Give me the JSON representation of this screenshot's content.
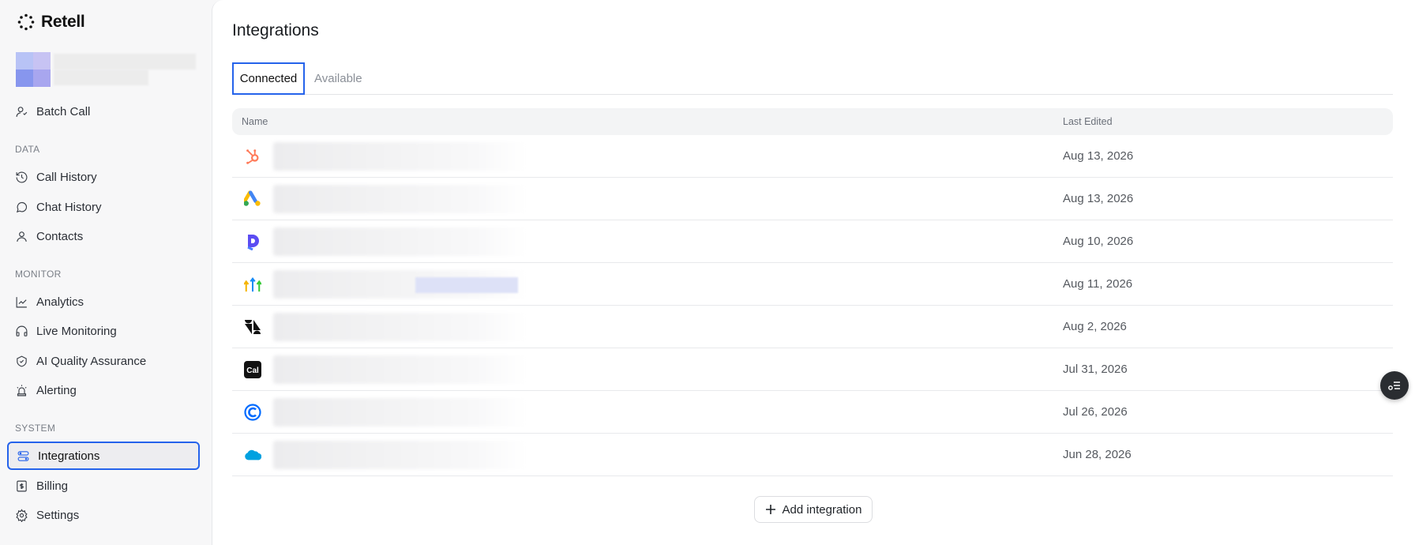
{
  "brand": {
    "name": "Retell"
  },
  "sidebar": {
    "top_items": [
      {
        "label": "Batch Call",
        "icon": "batch-call-icon"
      }
    ],
    "sections": [
      {
        "label": "DATA",
        "items": [
          {
            "label": "Call History",
            "icon": "history-icon"
          },
          {
            "label": "Chat History",
            "icon": "chat-icon"
          },
          {
            "label": "Contacts",
            "icon": "user-icon"
          }
        ]
      },
      {
        "label": "MONITOR",
        "items": [
          {
            "label": "Analytics",
            "icon": "chart-icon"
          },
          {
            "label": "Live Monitoring",
            "icon": "headphones-icon"
          },
          {
            "label": "AI Quality Assurance",
            "icon": "shield-check-icon"
          },
          {
            "label": "Alerting",
            "icon": "siren-icon"
          }
        ]
      },
      {
        "label": "SYSTEM",
        "items": [
          {
            "label": "Integrations",
            "icon": "integrations-icon",
            "active": true
          },
          {
            "label": "Billing",
            "icon": "receipt-icon"
          },
          {
            "label": "Settings",
            "icon": "gear-icon"
          }
        ]
      }
    ]
  },
  "main": {
    "title": "Integrations",
    "tabs": [
      {
        "label": "Connected",
        "active": true
      },
      {
        "label": "Available"
      }
    ],
    "table": {
      "columns": [
        "Name",
        "Last Edited"
      ],
      "rows": [
        {
          "icon": "hubspot-icon",
          "last_edited": "Aug 13, 2026"
        },
        {
          "icon": "google-ads-icon",
          "last_edited": "Aug 13, 2026"
        },
        {
          "icon": "dialpad-icon",
          "last_edited": "Aug 10, 2026"
        },
        {
          "icon": "gohighlevel-icon",
          "last_edited": "Aug 11, 2026"
        },
        {
          "icon": "zendesk-icon",
          "last_edited": "Aug 2, 2026"
        },
        {
          "icon": "cal-com-icon",
          "last_edited": "Jul 31, 2026"
        },
        {
          "icon": "calendly-icon",
          "last_edited": "Jul 26, 2026"
        },
        {
          "icon": "salesforce-icon",
          "last_edited": "Jun 28, 2026"
        }
      ]
    },
    "add_button": {
      "label": "Add integration"
    }
  },
  "colors": {
    "accent": "#2563eb",
    "background": "#f7f7f8"
  }
}
